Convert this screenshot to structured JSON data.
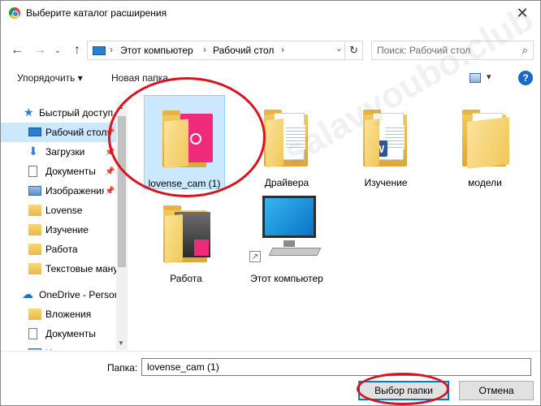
{
  "window": {
    "title": "Выберите каталог расширения",
    "close_glyph": "✕"
  },
  "address": {
    "crumbs": [
      "Этот компьютер",
      "Рабочий стол"
    ],
    "search_placeholder": "Поиск: Рабочий стол"
  },
  "toolbar": {
    "organize_label": "Упорядочить ▾",
    "new_folder_label": "Новая папка",
    "help_label": "?"
  },
  "nav": {
    "items": [
      {
        "label": "Быстрый доступ",
        "icon": "star-icon",
        "pinned": false
      },
      {
        "label": "Рабочий стол",
        "icon": "desktop-icon",
        "pinned": true,
        "selected": true
      },
      {
        "label": "Загрузки",
        "icon": "download-icon",
        "pinned": true
      },
      {
        "label": "Документы",
        "icon": "documents-icon",
        "pinned": true
      },
      {
        "label": "Изображения",
        "icon": "pictures-icon",
        "pinned": true
      },
      {
        "label": "Lovense",
        "icon": "folder-icon",
        "pinned": false
      },
      {
        "label": "Изучение",
        "icon": "folder-icon",
        "pinned": false
      },
      {
        "label": "Работа",
        "icon": "folder-icon",
        "pinned": false
      },
      {
        "label": "Текстовые ману",
        "icon": "folder-icon",
        "pinned": false
      },
      {
        "label": "OneDrive - Person",
        "icon": "cloud-icon",
        "pinned": false
      },
      {
        "label": "Вложения",
        "icon": "folder-icon",
        "pinned": false
      },
      {
        "label": "Документы",
        "icon": "documents-icon",
        "pinned": false
      },
      {
        "label": "Из",
        "icon": "pictures-icon",
        "pinned": false
      }
    ]
  },
  "content": {
    "tiles": [
      {
        "label": "lovense_cam (1)",
        "selected": true
      },
      {
        "label": "Драйвера"
      },
      {
        "label": "Изучение"
      },
      {
        "label": "модели"
      },
      {
        "label": "Работа"
      },
      {
        "label": "Этот компьютер"
      }
    ]
  },
  "bottom": {
    "folder_label": "Папка:",
    "folder_value": "lovense_cam (1)",
    "select_button": "Выбор папки",
    "cancel_button": "Отмена"
  },
  "watermark": "salavyoubo.club",
  "colors": {
    "selection": "#cce8ff",
    "accent": "#0078d7",
    "annotation": "#d8141e"
  }
}
